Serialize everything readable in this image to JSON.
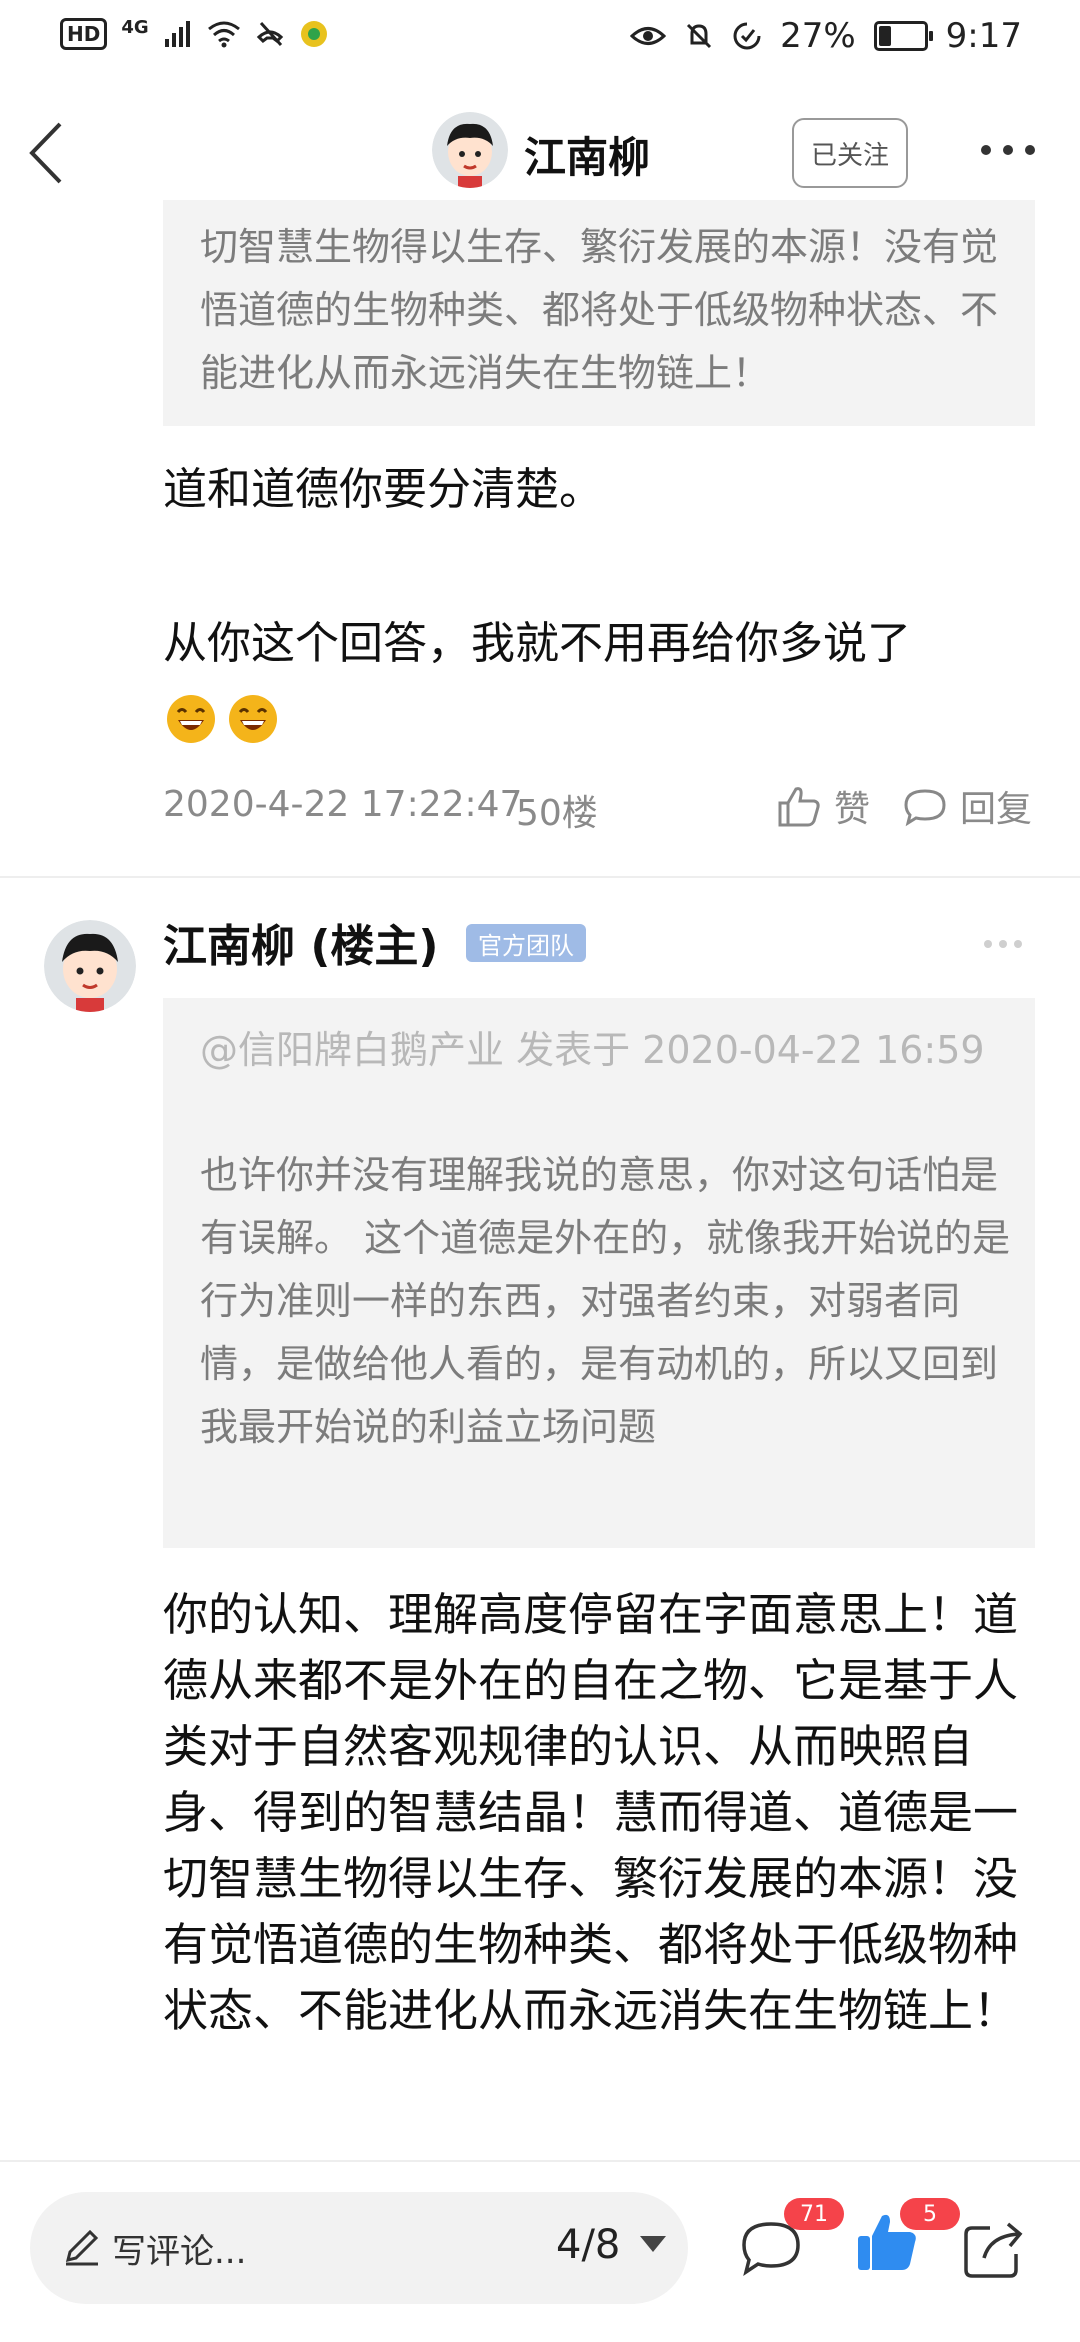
{
  "status_bar": {
    "hd": "HD",
    "network": "4G",
    "battery_percent_text": "27%",
    "battery_level": 0.27,
    "time": "9:17"
  },
  "header": {
    "username": "江南柳",
    "follow_label": "已关注"
  },
  "post1": {
    "quote_text": "切智慧生物得以生存、繁衍发展的本源！没有觉悟道德的生物种类、都将处于低级物种状态、不能进化从而永远消失在生物链上！",
    "line1": "道和道德你要分清楚。",
    "line2": "从你这个回答，我就不用再给你多说了",
    "timestamp": "2020-4-22 17:22:47",
    "floor": "50楼",
    "like_label": "赞",
    "reply_label": "回复"
  },
  "post2": {
    "author": "江南柳 (楼主)",
    "badge": "官方团队",
    "quote_header": "@信阳牌白鹅产业 发表于 2020-04-22 16:59",
    "quote_text": "也许你并没有理解我说的意思，你对这句话怕是有误解。 这个道德是外在的，就像我开始说的是行为准则一样的东西，对强者约束，对弱者同情，是做给他人看的，是有动机的，所以又回到我最开始说的利益立场问题",
    "body": "你的认知、理解高度停留在字面意思上！道德从来都不是外在的自在之物、它是基于人类对于自然客观规律的认识、从而映照自身、得到的智慧结晶！慧而得道、道德是一切智慧生物得以生存、繁衍发展的本源！没有觉悟道德的生物种类、都将处于低级物种状态、不能进化从而永远消失在生物链上！"
  },
  "bottom_bar": {
    "comment_placeholder": "写评论...",
    "page_indicator": "4/8",
    "comment_count": "71",
    "like_count": "5",
    "colors": {
      "accent": "#2f8cf0",
      "badge": "#f5434a"
    }
  }
}
